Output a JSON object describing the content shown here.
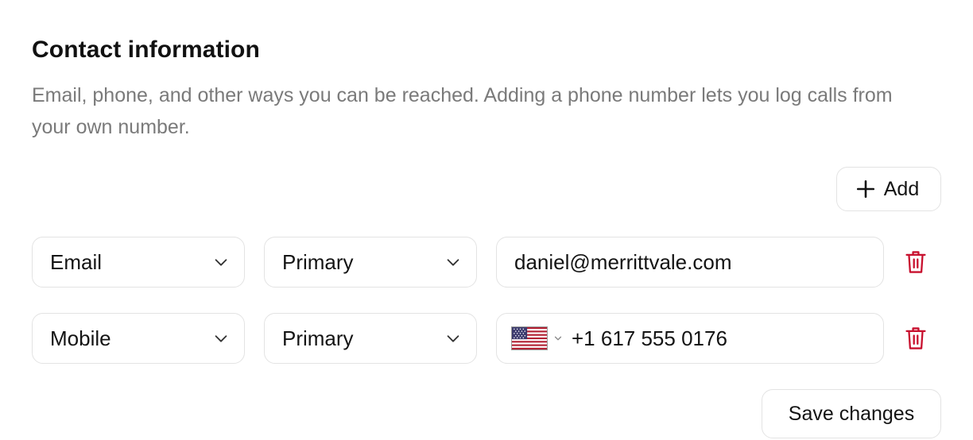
{
  "section": {
    "title": "Contact information",
    "description": "Email, phone, and other ways you can be reached. Adding a phone number lets you log calls from your own number."
  },
  "add_button": {
    "label": "Add",
    "icon": "plus-icon"
  },
  "rows": [
    {
      "type": "Email",
      "priority": "Primary",
      "value": "daniel@merrittvale.com",
      "delete_icon": "trash-icon"
    },
    {
      "type": "Mobile",
      "priority": "Primary",
      "country_flag": "us-flag-icon",
      "value": "+1 617 555 0176",
      "delete_icon": "trash-icon"
    }
  ],
  "save_button": {
    "label": "Save changes"
  },
  "colors": {
    "danger": "#c8102e",
    "muted_text": "#7a7a7a",
    "border": "#e3e3e3"
  }
}
